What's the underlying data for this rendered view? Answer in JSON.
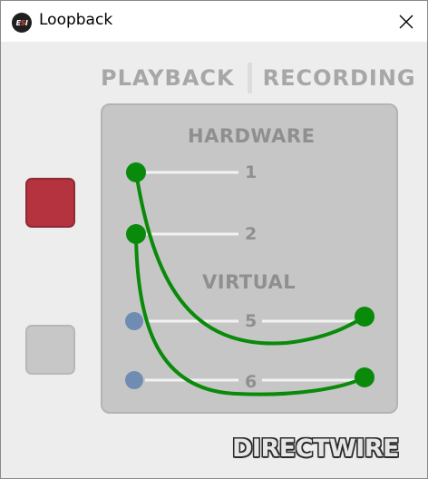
{
  "window": {
    "title": "Loopback",
    "app_icon": "esi-logo-icon"
  },
  "tabs": [
    {
      "label": "PLAYBACK"
    },
    {
      "label": "RECORDING"
    }
  ],
  "panel": {
    "hardware_title": "HARDWARE",
    "virtual_title": "VIRTUAL",
    "rows": [
      {
        "label": "1",
        "group": "hardware"
      },
      {
        "label": "2",
        "group": "hardware"
      },
      {
        "label": "5",
        "group": "virtual"
      },
      {
        "label": "6",
        "group": "virtual"
      }
    ]
  },
  "connections": [
    {
      "from": "1",
      "to": "5"
    },
    {
      "from": "2",
      "to": "6"
    }
  ],
  "buttons": [
    {
      "name": "red",
      "state": "active"
    },
    {
      "name": "gray",
      "state": "inactive"
    }
  ],
  "logo": {
    "text": "DIRECTWIRE"
  },
  "colors": {
    "connection": "#0a8a0a",
    "node_inactive": "#6f8db3",
    "button_active": "#b5323f",
    "button_inactive": "#c7c7c7",
    "label": "#8f8f8f",
    "tab_text": "#a7a7a7",
    "panel_bg": "#c6c6c6"
  }
}
